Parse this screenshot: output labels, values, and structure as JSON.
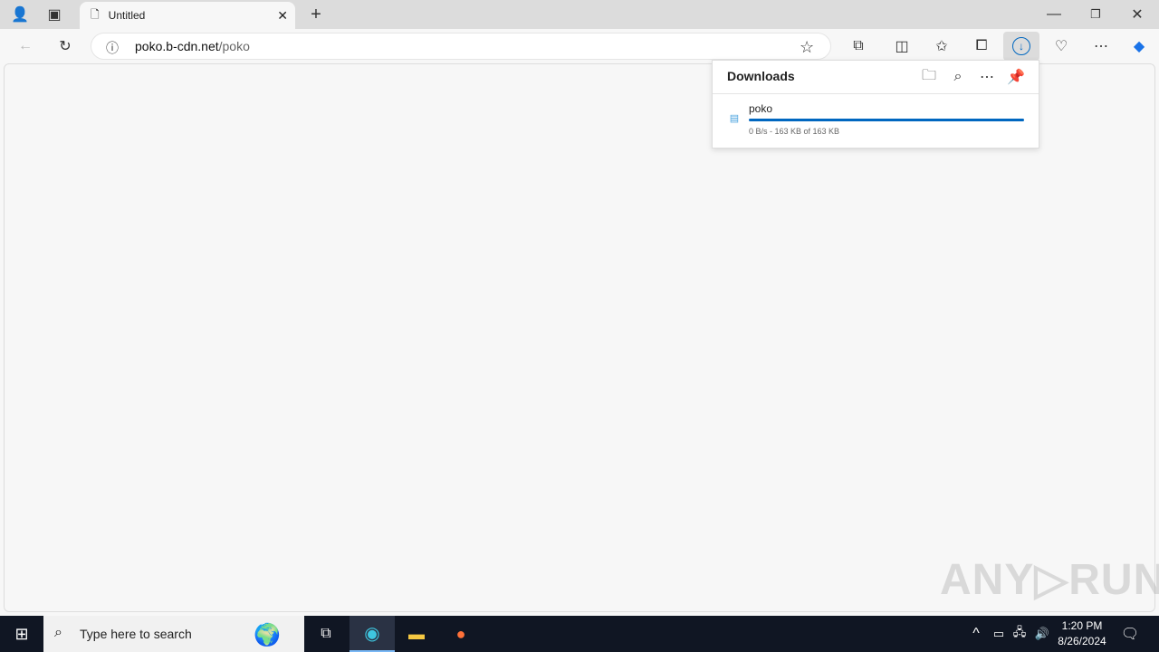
{
  "browser": {
    "tab_title": "Untitled",
    "url_host": "poko.b-cdn.net",
    "url_path": "/poko"
  },
  "downloads": {
    "title": "Downloads",
    "items": [
      {
        "name": "poko",
        "status": "0 B/s - 163 KB of 163 KB",
        "progress_percent": 100
      }
    ],
    "accent": "#0067c0"
  },
  "taskbar": {
    "search_placeholder": "Type here to search",
    "time": "1:20 PM",
    "date": "8/26/2024"
  },
  "watermark": "ANY RUN"
}
